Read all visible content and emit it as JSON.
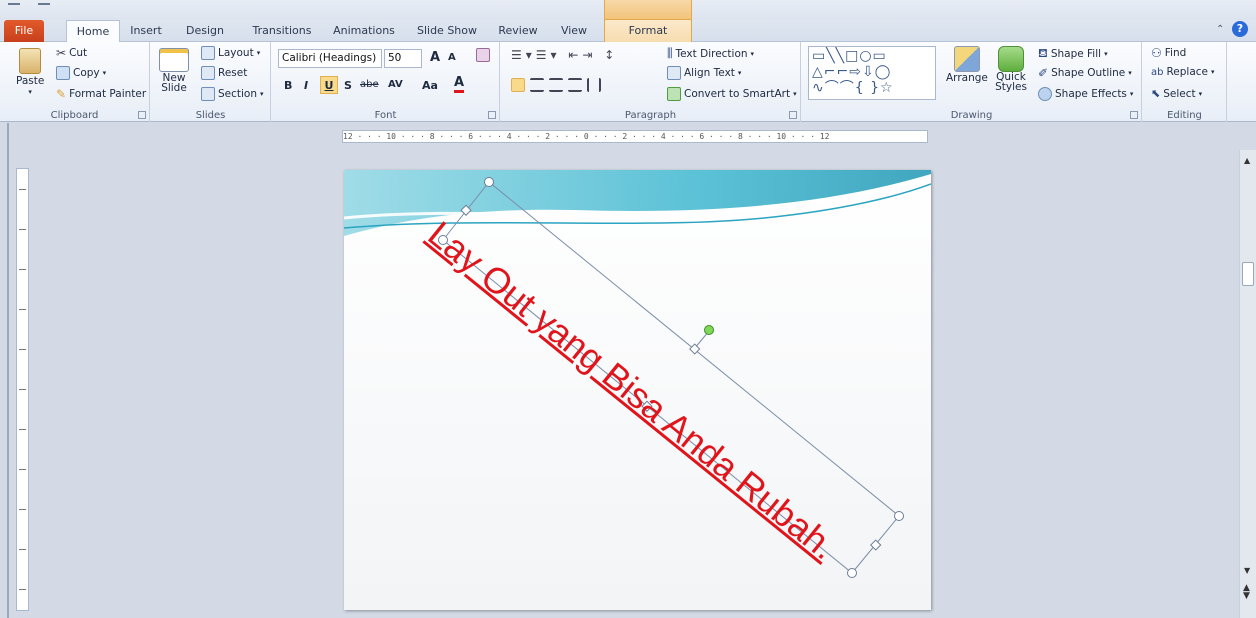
{
  "tabs": {
    "file": "File",
    "home": "Home",
    "insert": "Insert",
    "design": "Design",
    "transitions": "Transitions",
    "animations": "Animations",
    "slide_show": "Slide Show",
    "review": "Review",
    "view": "View",
    "format": "Format"
  },
  "clipboard": {
    "paste": "Paste",
    "cut": "Cut",
    "copy": "Copy",
    "format_painter": "Format Painter",
    "label": "Clipboard"
  },
  "slides": {
    "new_slide": "New Slide",
    "layout": "Layout",
    "reset": "Reset",
    "section": "Section",
    "label": "Slides"
  },
  "font": {
    "name": "Calibri (Headings)",
    "size": "50",
    "label": "Font",
    "bold": "B",
    "italic": "I",
    "underline": "U",
    "shadow": "S",
    "strike": "abe",
    "spacing": "AV",
    "case": "Aa",
    "color": "A",
    "grow": "A",
    "shrink": "A"
  },
  "paragraph": {
    "text_direction": "Text Direction",
    "align_text": "Align Text",
    "convert_smartart": "Convert to SmartArt",
    "label": "Paragraph"
  },
  "drawing": {
    "arrange": "Arrange",
    "quick_styles": "Quick Styles",
    "shape_fill": "Shape Fill",
    "shape_outline": "Shape Outline",
    "shape_effects": "Shape Effects",
    "label": "Drawing"
  },
  "editing": {
    "find": "Find",
    "replace": "Replace",
    "select": "Select",
    "label": "Editing"
  },
  "ruler": {
    "horizontal": "12 · · · 10 · · · 8 · · · 6 · · · 4 · · · 2 · · · 0 · · · 2 · · · 4 · · · 6 · · · 8 · · · 10 · · · 12"
  },
  "slide": {
    "text": "Lay Out yang Bisa Anda Rubah."
  },
  "colors": {
    "accent_red": "#e0141a",
    "file_tab": "#d24a20",
    "wave": "#3fb7cf"
  }
}
